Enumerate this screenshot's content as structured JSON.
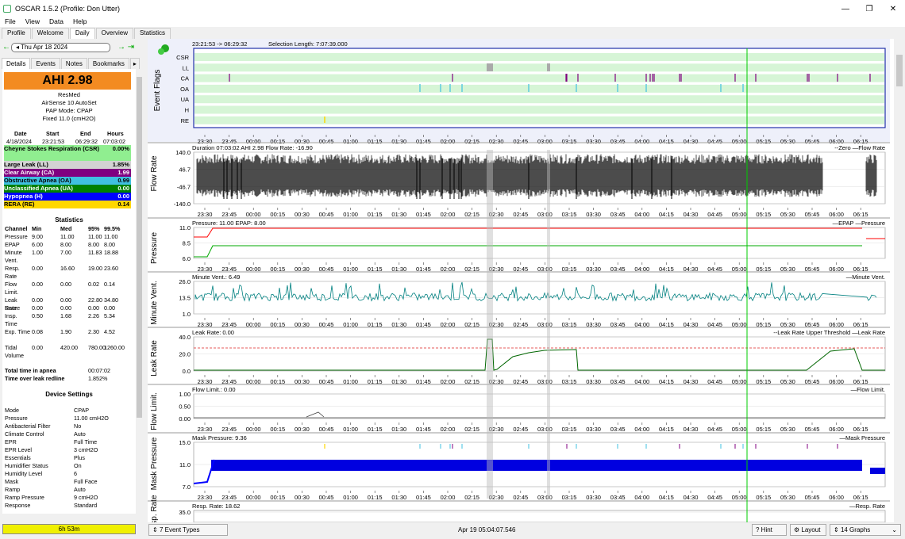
{
  "app": {
    "title": "OSCAR 1.5.2 (Profile: Don Utter)"
  },
  "menu": [
    "File",
    "View",
    "Data",
    "Help"
  ],
  "tabs": [
    "Profile",
    "Welcome",
    "Daily",
    "Overview",
    "Statistics"
  ],
  "date": "Thu Apr 18 2024",
  "subtabs": [
    "Details",
    "Events",
    "Notes",
    "Bookmarks"
  ],
  "summary": {
    "ahi": "AHI 2.98",
    "machine": "ResMed",
    "model": "AirSense 10 AutoSet",
    "mode": "PAP Mode: CPAP",
    "fixed": "Fixed 11.0 (cmH2O)"
  },
  "session": {
    "headers": [
      "Date",
      "Start",
      "End",
      "Hours"
    ],
    "values": [
      "4/18/2024",
      "23:21:53",
      "06:29:32",
      "07:03:02"
    ]
  },
  "events": [
    {
      "label": "Cheyne Stokes Respiration (CSR)",
      "value": "0.00%",
      "color": "#90ee90",
      "tc": "#000"
    },
    {
      "label": "Large Leak (LL)",
      "value": "1.85%",
      "color": "#d3d3d3",
      "tc": "#000"
    },
    {
      "label": "Clear Airway (CA)",
      "value": "1.99",
      "color": "#800080",
      "tc": "#fff"
    },
    {
      "label": "Obstructive Apnea (OA)",
      "value": "0.99",
      "color": "#40c0e0",
      "tc": "#000"
    },
    {
      "label": "Unclassified Apnea (UA)",
      "value": "0.00",
      "color": "#008000",
      "tc": "#fff"
    },
    {
      "label": "Hypopnea (H)",
      "value": "0.00",
      "color": "#0000ff",
      "tc": "#fff"
    },
    {
      "label": "RERA (RE)",
      "value": "0.14",
      "color": "#ffd700",
      "tc": "#000"
    }
  ],
  "stats": {
    "title": "Statistics",
    "headers": [
      "Channel",
      "Min",
      "Med",
      "95%",
      "99.5%"
    ],
    "rows": [
      [
        "Pressure",
        "9.00",
        "11.00",
        "11.00",
        "11.00"
      ],
      [
        "EPAP",
        "6.00",
        "8.00",
        "8.00",
        "8.00"
      ],
      [
        "Minute Vent.",
        "1.00",
        "7.00",
        "11.83",
        "18.88"
      ],
      [
        "Resp. Rate",
        "0.00",
        "16.60",
        "19.00",
        "23.60"
      ],
      [
        "Flow Limit.",
        "0.00",
        "0.00",
        "0.02",
        "0.14"
      ],
      [
        "Leak Rate",
        "0.00",
        "0.00",
        "22.80",
        "34.80"
      ],
      [
        "Snore",
        "0.00",
        "0.00",
        "0.00",
        "0.00"
      ],
      [
        "Insp. Time",
        "0.50",
        "1.68",
        "2.26",
        "5.34"
      ],
      [
        "Exp. Time",
        "0.08",
        "1.90",
        "2.30",
        "4.52"
      ],
      [
        "Tidal Volume",
        "0.00",
        "420.00",
        "780.00",
        "1260.00"
      ]
    ],
    "apnea_label": "Total time in apnea",
    "apnea_value": "00:07:02",
    "redline_label": "Time over leak redline",
    "redline_value": "1.852%"
  },
  "device": {
    "title": "Device Settings",
    "rows": [
      [
        "Mode",
        "CPAP"
      ],
      [
        "Pressure",
        "11.00 cmH2O"
      ],
      [
        "Antibacterial Filter",
        "No"
      ],
      [
        "Climate Control",
        "Auto"
      ],
      [
        "EPR",
        "Full Time"
      ],
      [
        "EPR Level",
        "3 cmH2O"
      ],
      [
        "Essentials",
        "Plus"
      ],
      [
        "Humidifier Status",
        "On"
      ],
      [
        "Humidity Level",
        "6"
      ],
      [
        "Mask",
        "Full Face"
      ],
      [
        "Ramp",
        "Auto"
      ],
      [
        "Ramp Pressure",
        "9 cmH2O"
      ],
      [
        "Response",
        "Standard"
      ]
    ]
  },
  "graph_header": {
    "range": "23:21:53 -> 06:29:32",
    "selection": "Selection Length: 7:07:39.000"
  },
  "time_ticks": [
    "23:30",
    "23:45",
    "00:00",
    "00:15",
    "00:30",
    "00:45",
    "01:00",
    "01:15",
    "01:30",
    "01:45",
    "02:00",
    "02:15",
    "02:30",
    "02:45",
    "03:00",
    "03:15",
    "03:30",
    "03:45",
    "04:00",
    "04:15",
    "04:30",
    "04:45",
    "05:00",
    "05:15",
    "05:30",
    "05:45",
    "06:00",
    "06:15"
  ],
  "event_flags": {
    "label": "Event Flags",
    "rows": [
      "CSR",
      "LL",
      "CA",
      "OA",
      "UA",
      "H",
      "RE"
    ]
  },
  "graphs": [
    {
      "id": "flow",
      "label": "Flow Rate",
      "header": "Duration 07:03:02 AHI 2.98 Flow Rate: -16.90",
      "legend": "--Zero —Flow Rate",
      "yticks": [
        "140.0",
        "46.7",
        "-46.7",
        "-140.0"
      ],
      "color": "#000000"
    },
    {
      "id": "pressure",
      "label": "Pressure",
      "header": "Pressure: 11.00 EPAP: 8.00",
      "legend": "—EPAP —Pressure",
      "yticks": [
        "11.0",
        "8.5",
        "6.0"
      ],
      "color": "#ff0000"
    },
    {
      "id": "minvent",
      "label": "Minute Vent.",
      "header": "Minute Vent.: 6.49",
      "legend": "—Minute Vent.",
      "yticks": [
        "26.0",
        "13.5",
        "1.0"
      ],
      "color": "#008080"
    },
    {
      "id": "leak",
      "label": "Leak Rate",
      "header": "Leak Rate: 0.00",
      "legend": "--Leak Rate Upper Threshold —Leak Rate",
      "yticks": [
        "40.0",
        "20.0",
        "0.0"
      ],
      "color": "#008000"
    },
    {
      "id": "flowlimit",
      "label": "Flow Limit.",
      "header": "Flow Limit.: 0.00",
      "legend": "—Flow Limit.",
      "yticks": [
        "1.00",
        "0.50",
        "0.00"
      ],
      "color": "#404040"
    },
    {
      "id": "maskp",
      "label": "Mask Pressure",
      "header": "Mask Pressure: 9.36",
      "legend": "—Mask Pressure",
      "yticks": [
        "15.0",
        "11.0",
        "7.0"
      ],
      "color": "#0000ff"
    },
    {
      "id": "resp",
      "label": "Resp. Rate",
      "header": "Resp. Rate: 18.62",
      "legend": "—Resp. Rate",
      "yticks": [
        "35.0"
      ],
      "color": "#800080"
    }
  ],
  "bottom": {
    "duration": "6h 53m",
    "event_types": "7 Event Types",
    "timestamp": "Apr 19 05:04:07.546",
    "hint": "Hint",
    "layout": "Layout",
    "graphs": "14 Graphs"
  }
}
